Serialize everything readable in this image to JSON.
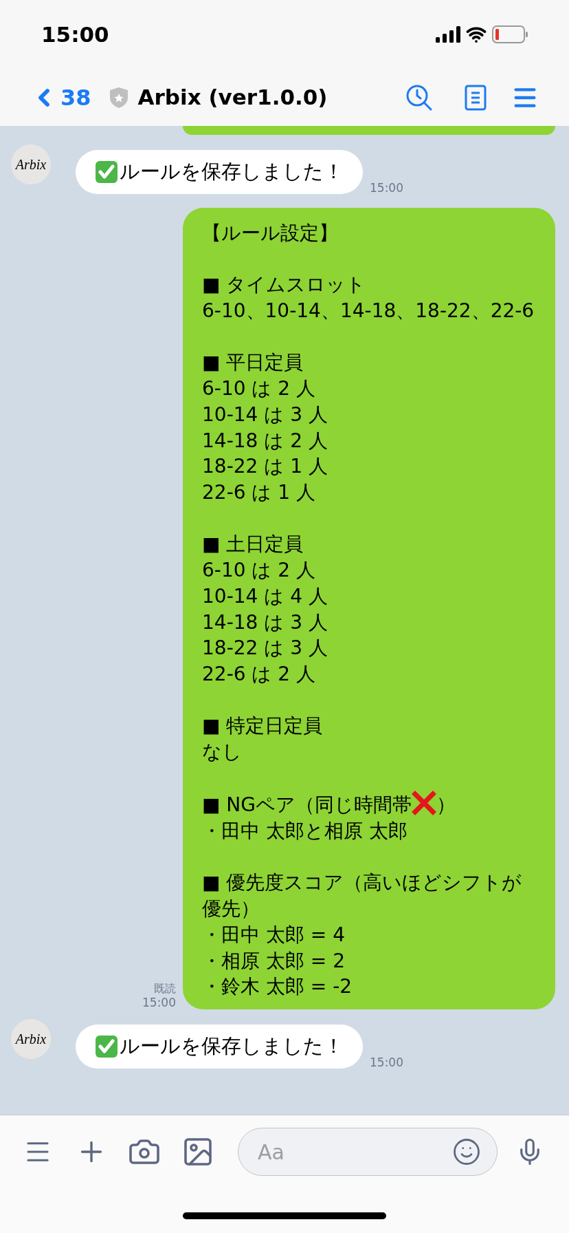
{
  "status_bar": {
    "time": "15:00"
  },
  "header": {
    "back_count": "38",
    "title": "Arbix (ver1.0.0)"
  },
  "messages": [
    {
      "kind": "partial_outgoing"
    },
    {
      "kind": "incoming",
      "avatar": "Arbix",
      "text": "ルールを保存しました！",
      "time": "15:00"
    },
    {
      "kind": "outgoing",
      "read": "既読",
      "time": "15:00",
      "title": "【ルール設定】",
      "sections": [
        {
          "heading": "■ タイムスロット",
          "lines": [
            "6-10、10-14、14-18、18-22、22-6"
          ]
        },
        {
          "heading": "■ 平日定員",
          "lines": [
            "6-10 は 2 人",
            "10-14 は 3 人",
            "14-18 は 2 人",
            "18-22 は 1 人",
            "22-6 は 1 人"
          ]
        },
        {
          "heading": "■ 土日定員",
          "lines": [
            "6-10 は 2 人",
            "10-14 は 4 人",
            "14-18 は 3 人",
            "18-22 は 3 人",
            "22-6 は 2 人"
          ]
        },
        {
          "heading": "■ 特定日定員",
          "lines": [
            "なし"
          ]
        },
        {
          "kind": "marked",
          "heading": "■ NGペア（同じ時間帯",
          "heading_end": "）",
          "lines": [
            "・田中 太郎と相原 太郎"
          ]
        },
        {
          "heading": "■ 優先度スコア（高いほどシフトが優先）",
          "lines": [
            "・田中 太郎 = 4",
            "・相原 太郎 = 2",
            "・鈴木 太郎 = -2"
          ]
        }
      ]
    },
    {
      "kind": "incoming",
      "avatar": "Arbix",
      "text": "ルールを保存しました！",
      "time": "15:00"
    }
  ],
  "composer": {
    "placeholder": "Aa"
  }
}
